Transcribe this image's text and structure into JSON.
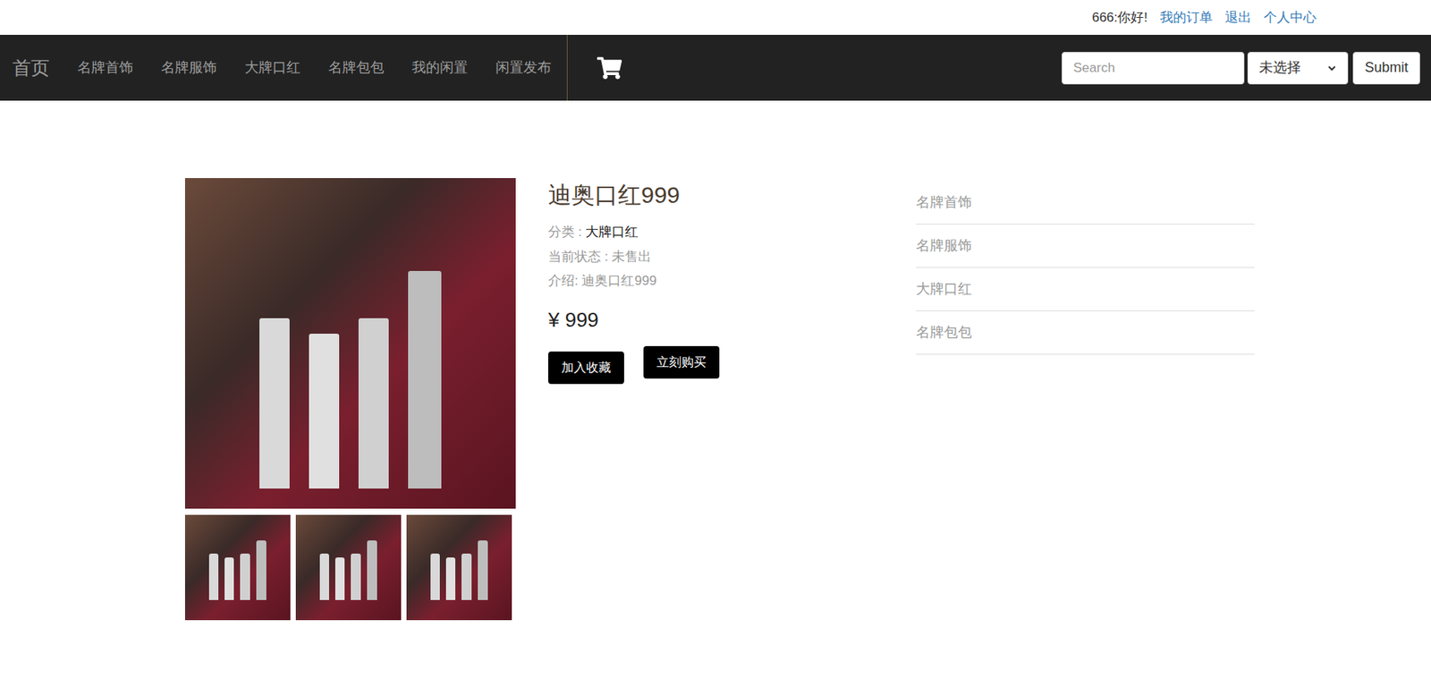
{
  "top_bar": {
    "greeting": "666:你好!",
    "links": [
      "我的订单",
      "退出",
      "个人中心"
    ]
  },
  "navbar": {
    "brand": "首页",
    "items": [
      "名牌首饰",
      "名牌服饰",
      "大牌口红",
      "名牌包包",
      "我的闲置",
      "闲置发布"
    ]
  },
  "search": {
    "placeholder": "Search",
    "select": "未选择",
    "submit": "Submit"
  },
  "product": {
    "title": "迪奥口红999",
    "fields": [
      {
        "label": "分类 :",
        "value": "大牌口红",
        "highlight": true
      },
      {
        "label": "当前状态 :",
        "value": "未售出",
        "highlight": false
      },
      {
        "label": "介绍:",
        "value": "迪奥口红999",
        "highlight": false
      }
    ],
    "price": "¥ 999",
    "buttons": [
      "加入收藏",
      "立刻购买"
    ]
  },
  "sidebar": {
    "items": [
      "名牌首饰",
      "名牌服饰",
      "大牌口红",
      "名牌包包"
    ]
  }
}
